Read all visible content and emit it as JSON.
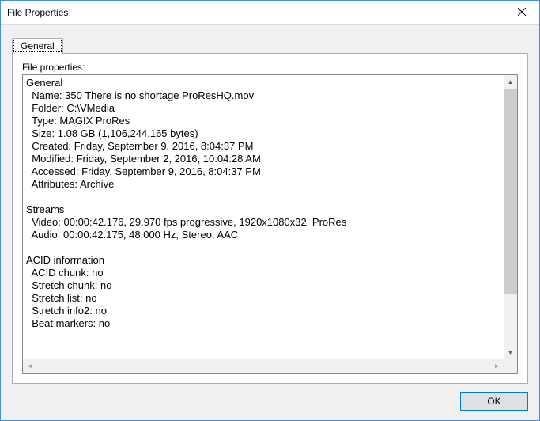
{
  "window": {
    "title": "File Properties"
  },
  "tabs": {
    "general": "General"
  },
  "section_label": "File properties:",
  "groups": {
    "general": {
      "title": "General",
      "name_label": "Name:",
      "name_value": "350 There is no shortage ProResHQ.mov",
      "folder_label": "Folder:",
      "folder_value": "C:\\VMedia",
      "type_label": "Type:",
      "type_value": "MAGIX ProRes",
      "size_label": "Size:",
      "size_value": "1.08 GB (1,106,244,165 bytes)",
      "created_label": "Created:",
      "created_value": "Friday, September 9, 2016, 8:04:37 PM",
      "modified_label": "Modified:",
      "modified_value": "Friday, September 2, 2016, 10:04:28 AM",
      "accessed_label": "Accessed:",
      "accessed_value": "Friday, September 9, 2016, 8:04:37 PM",
      "attributes_label": "Attributes:",
      "attributes_value": "Archive"
    },
    "streams": {
      "title": "Streams",
      "video_label": "Video:",
      "video_value": "00:00:42.176, 29.970 fps progressive, 1920x1080x32, ProRes",
      "audio_label": "Audio:",
      "audio_value": "00:00:42.175, 48,000 Hz, Stereo, AAC"
    },
    "acid": {
      "title": "ACID information",
      "acid_chunk_label": "ACID chunk:",
      "acid_chunk_value": "no",
      "stretch_chunk_label": "Stretch chunk:",
      "stretch_chunk_value": "no",
      "stretch_list_label": "Stretch list:",
      "stretch_list_value": "no",
      "stretch_info2_label": "Stretch info2:",
      "stretch_info2_value": "no",
      "beat_markers_label": "Beat markers:",
      "beat_markers_value": "no"
    }
  },
  "buttons": {
    "ok": "OK"
  }
}
